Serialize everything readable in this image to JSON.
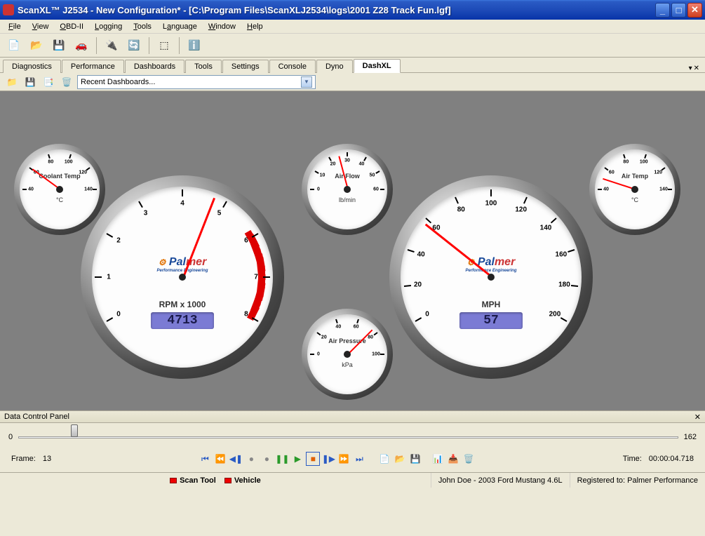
{
  "window": {
    "title": "ScanXL™ J2534 - New Configuration* - [C:\\Program Files\\ScanXLJ2534\\logs\\2001 Z28 Track Fun.lgf]"
  },
  "menu": [
    "File",
    "View",
    "OBD-II",
    "Logging",
    "Tools",
    "Language",
    "Window",
    "Help"
  ],
  "tabs": [
    "Diagnostics",
    "Performance",
    "Dashboards",
    "Tools",
    "Settings",
    "Console",
    "Dyno",
    "DashXL"
  ],
  "active_tab": "DashXL",
  "dash_dropdown": "Recent Dashboards...",
  "gauges": {
    "rpm": {
      "label": "RPM x 1000",
      "value": "4713",
      "reading_num": 4.713,
      "min": 0,
      "max": 8,
      "redline_start": 6
    },
    "mph": {
      "label": "MPH",
      "value": "57",
      "reading_num": 57,
      "min": 0,
      "max": 200
    },
    "coolant": {
      "label": "Coolant Temp",
      "unit": "°C",
      "min": 40,
      "max": 140,
      "reading": 60
    },
    "airflow": {
      "label": "Air Flow",
      "unit": "lb/min",
      "min": 0,
      "max": 60,
      "reading": 25
    },
    "airtemp": {
      "label": "Air Temp",
      "unit": "°C",
      "min": 40,
      "max": 140,
      "reading": 50
    },
    "pressure": {
      "label": "Air Pressure",
      "unit": "kPa",
      "min": 0,
      "max": 100,
      "reading": 75
    }
  },
  "brand": {
    "name_a": "Pal",
    "name_b": "mer",
    "tagline": "Performance Engineering"
  },
  "dcp": {
    "title": "Data Control Panel",
    "slider_min": "0",
    "slider_max": "162",
    "slider_pos_pct": 8,
    "frame_label": "Frame:",
    "frame_value": "13",
    "time_label": "Time:",
    "time_value": "00:00:04.718"
  },
  "status": {
    "scan_tool": "Scan Tool",
    "vehicle": "Vehicle",
    "user": "John Doe - 2003 Ford Mustang 4.6L",
    "reg": "Registered to: Palmer Performance"
  }
}
